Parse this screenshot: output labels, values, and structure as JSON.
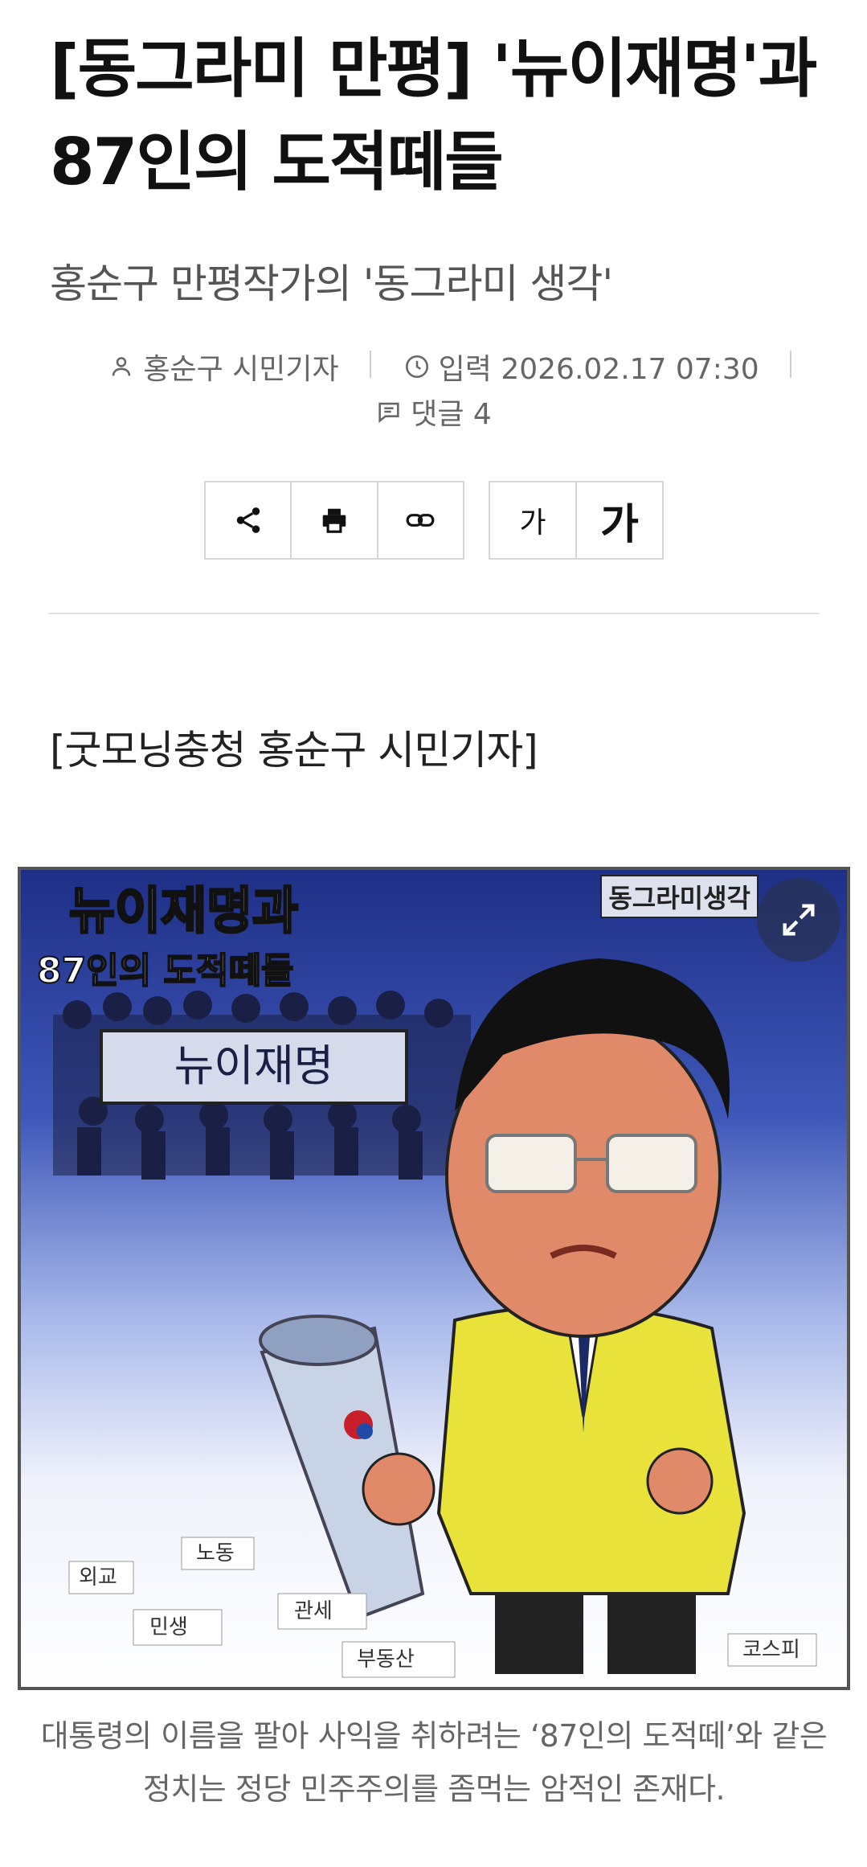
{
  "article": {
    "title": "[동그라미 만평] '뉴이재명'과 87인의 도적떼들",
    "subtitle": "홍순구 만평작가의 '동그라미 생각'",
    "byline": "[굿모닝충청 홍순구 시민기자]"
  },
  "meta": {
    "author": "홍순구 시민기자",
    "published": "입력 2026.02.17 07:30",
    "comments": "댓글 4"
  },
  "toolbar": {
    "share_icon": "share-icon",
    "print_icon": "print-icon",
    "link_icon": "link-icon",
    "font_small_label": "가",
    "font_large_label": "가"
  },
  "figure": {
    "brand": "동그라미생각",
    "headline_line1": "뉴이재명과",
    "headline_line2": "87인의 도적떼들",
    "banner": "뉴이재명",
    "papers": [
      "외교",
      "노동",
      "민생",
      "관세",
      "부동산",
      "코스피"
    ],
    "expand_icon": "expand-icon",
    "colors": {
      "sky_top": "#1e2f86",
      "jacket": "#e8e23a",
      "skin": "#e08a6a"
    }
  },
  "caption": "대통령의 이름을 팔아 사익을 취하려는 ‘87인의 도적떼’와 같은 정치는 정당 민주주의를 좀먹는 암적인 존재다."
}
